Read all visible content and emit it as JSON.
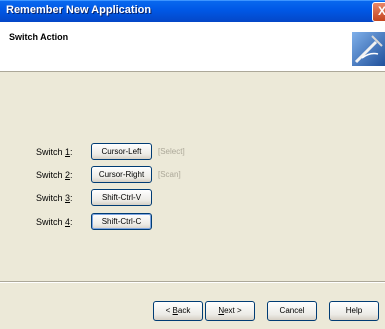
{
  "window": {
    "title": "Remember New Application",
    "close_label": "X"
  },
  "header": {
    "title": "Switch Action",
    "icon": "switch-wand-icon"
  },
  "switches": [
    {
      "label_prefix": "Switch ",
      "label_key": "1",
      "label_suffix": ":",
      "button": "Cursor-Left",
      "hint": "[Select]"
    },
    {
      "label_prefix": "Switch ",
      "label_key": "2",
      "label_suffix": ":",
      "button": "Cursor-Right",
      "hint": "[Scan]"
    },
    {
      "label_prefix": "Switch ",
      "label_key": "3",
      "label_suffix": ":",
      "button": "Shift-Ctrl-V",
      "hint": ""
    },
    {
      "label_prefix": "Switch ",
      "label_key": "4",
      "label_suffix": ":",
      "button": "Shift-Ctrl-C",
      "hint": ""
    }
  ],
  "footer": {
    "back_prefix": "< ",
    "back_key": "B",
    "back_rest": "ack",
    "next_key": "N",
    "next_rest": "ext >",
    "cancel": "Cancel",
    "help": "Help"
  },
  "colors": {
    "titlebar": "#0058e6",
    "dialog_bg": "#ece9d8",
    "hint": "#aca899"
  }
}
